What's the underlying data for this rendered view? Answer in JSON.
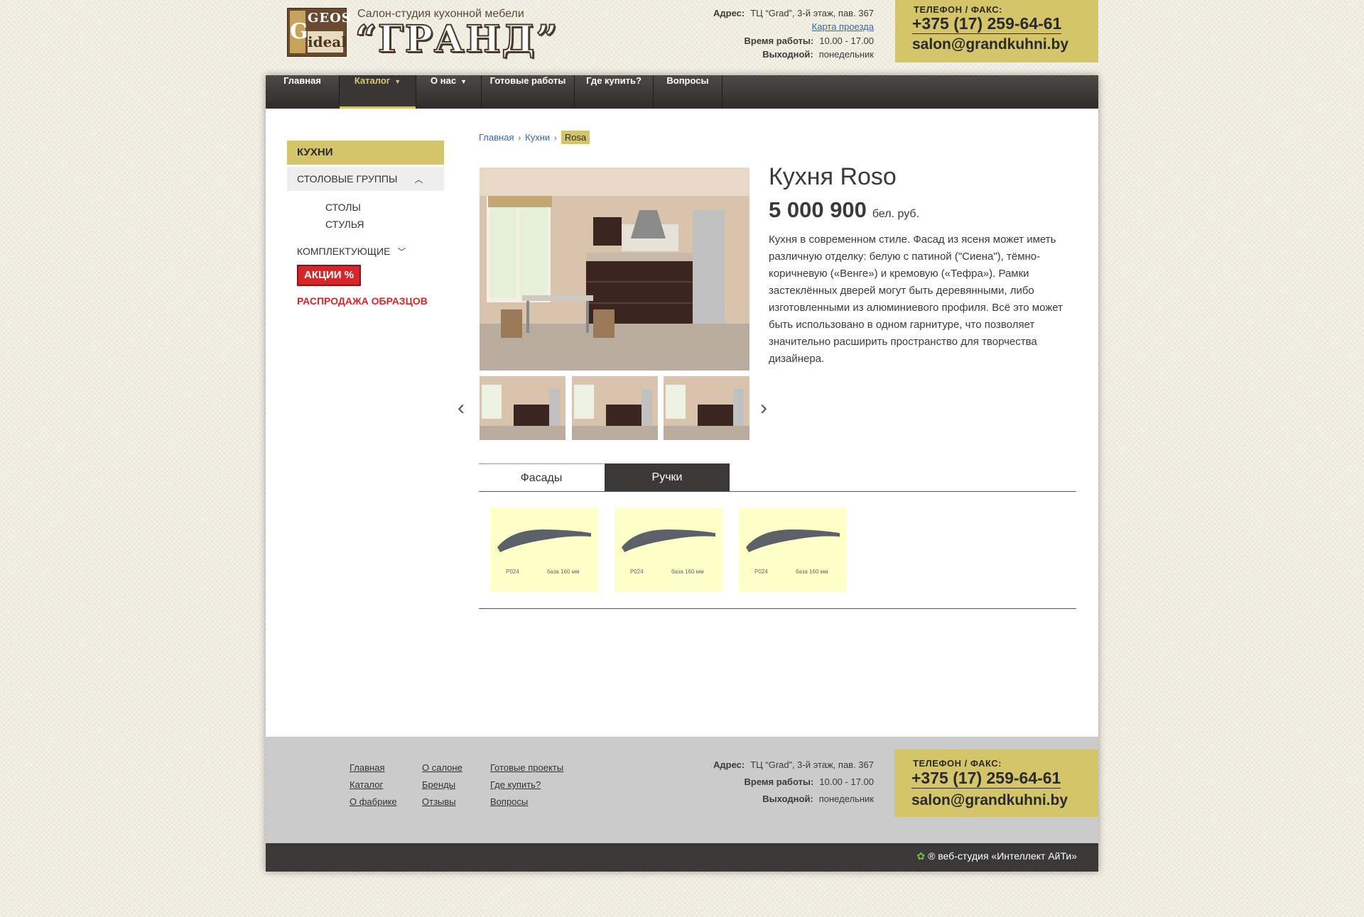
{
  "header": {
    "logo_top": "GEOS",
    "logo_letter": "G",
    "logo_bottom": "ideal",
    "subtitle": "Салон-студия кухонной мебели",
    "brand": "“ГРАНД”",
    "address_label": "Адрес:",
    "address": "ТЦ “Grad”, 3-й этаж, пав. 367",
    "map_link": "Карта проезда",
    "hours_label": "Время работы:",
    "hours": "10.00 - 17.00",
    "dayoff_label": "Выходной:",
    "dayoff": "понедельник",
    "contact_title": "ТЕЛЕФОН / ФАКС:",
    "phone": "+375 (17) 259-64-61",
    "email": "salon@grandkuhni.by"
  },
  "nav": {
    "items": [
      "Главная",
      "Каталог",
      "О нас",
      "Готовые работы",
      "Где купить?",
      "Вопросы"
    ],
    "active": "Каталог"
  },
  "sidebar": {
    "kitchens": "КУХНИ",
    "dining": "СТОЛОВЫЕ ГРУППЫ",
    "dining_sub": [
      "СТОЛЫ",
      "СТУЛЬЯ"
    ],
    "accessories": "КОМПЛЕКТУЮЩИЕ",
    "promo": "АКЦИИ %",
    "sale": "РАСПРОДАЖА ОБРАЗЦОВ"
  },
  "breadcrumb": {
    "items": [
      "Главная",
      "Кухни"
    ],
    "current": "Rosa"
  },
  "product": {
    "title": "Кухня Roso",
    "price": "5 000 900",
    "currency": "бел. руб.",
    "description": "Кухня в современном стиле.  Фасад из ясеня может иметь различную отделку: белую с патиной (\"Сиена\"), тёмно-коричневую («Венге») и кремовую («Тефра»). Рамки застеклённых дверей могут быть деревянными, либо изготовленными из алюминиевого профиля. Всё это может быть использовано в одном гарнитуре, что позволяет значительно расширить пространство для творчества дизайнера."
  },
  "tabs": [
    "Фасады",
    "Ручки"
  ],
  "handles": [
    {
      "code": "P024",
      "base": "база 160 мм"
    },
    {
      "code": "P024",
      "base": "база 160 мм"
    },
    {
      "code": "P024",
      "base": "база 160 мм"
    }
  ],
  "footer": {
    "links_col1": [
      "Главная",
      "Каталог",
      "О фабрике"
    ],
    "links_col2": [
      "О салоне",
      "Бренды",
      "Отзывы"
    ],
    "links_col3": [
      "Готовые проекты",
      "Где купить?",
      "Вопросы"
    ],
    "studio": "® веб-студия «Интеллект АйТи»"
  },
  "colors": {
    "accent": "#d4c46a",
    "dark": "#3b3838",
    "red": "#d3272b",
    "link": "#3068b4"
  }
}
